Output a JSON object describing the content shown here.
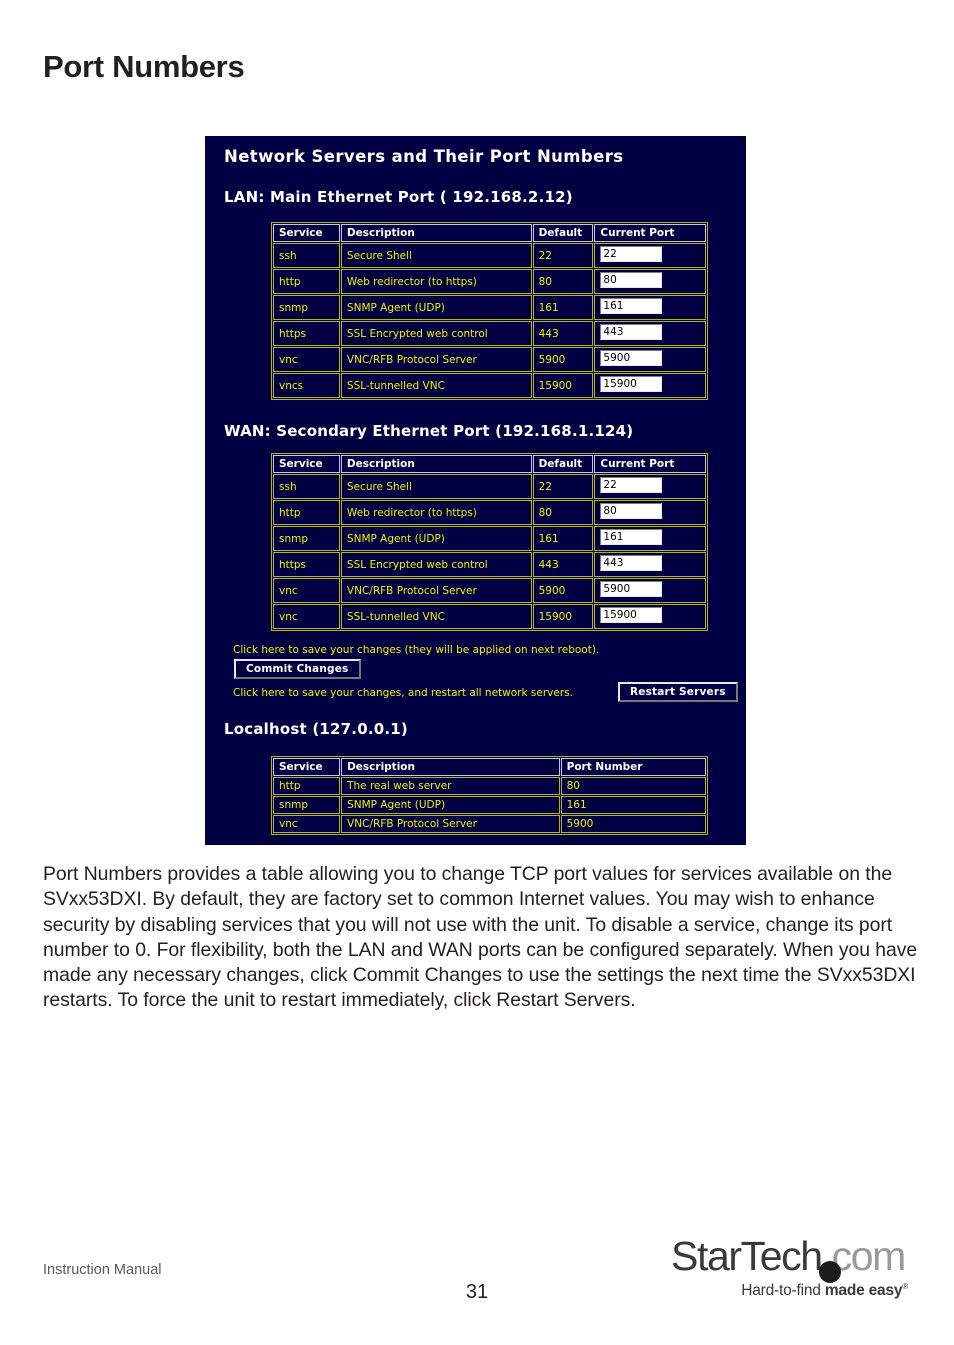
{
  "page": {
    "title": "Port Numbers",
    "body_paragraph": "Port Numbers provides a table allowing you to change TCP port values for services available on the SVxx53DXI. By default, they are factory set to common Internet values. You may wish to enhance security by disabling services that you will not use with the unit. To disable a service, change its port number to 0. For flexibility, both the LAN and WAN ports can be configured separately. When you have made any necessary changes, click Commit Changes to use the settings the next time the SVxx53DXI restarts. To force the unit to restart immediately, click Restart Servers."
  },
  "screenshot": {
    "title": "Network Servers and Their Port Numbers",
    "background_color": "#000042",
    "header_text_color": "#ffffff",
    "data_text_color": "#f2f200",
    "sections": {
      "lan": {
        "heading": "LAN: Main Ethernet Port ( 192.168.2.12)",
        "columns": [
          "Service",
          "Description",
          "Default",
          "Current Port"
        ],
        "rows": [
          {
            "service": "ssh",
            "description": "Secure Shell",
            "default": "22",
            "current": "22"
          },
          {
            "service": "http",
            "description": "Web redirector (to https)",
            "default": "80",
            "current": "80"
          },
          {
            "service": "snmp",
            "description": "SNMP Agent (UDP)",
            "default": "161",
            "current": "161"
          },
          {
            "service": "https",
            "description": "SSL Encrypted web control",
            "default": "443",
            "current": "443"
          },
          {
            "service": "vnc",
            "description": "VNC/RFB Protocol Server",
            "default": "5900",
            "current": "5900"
          },
          {
            "service": "vncs",
            "description": "SSL-tunnelled VNC",
            "default": "15900",
            "current": "15900"
          }
        ]
      },
      "wan": {
        "heading": "WAN: Secondary Ethernet Port (192.168.1.124)",
        "columns": [
          "Service",
          "Description",
          "Default",
          "Current Port"
        ],
        "rows": [
          {
            "service": "ssh",
            "description": "Secure Shell",
            "default": "22",
            "current": "22"
          },
          {
            "service": "http",
            "description": "Web redirector (to https)",
            "default": "80",
            "current": "80"
          },
          {
            "service": "snmp",
            "description": "SNMP Agent (UDP)",
            "default": "161",
            "current": "161"
          },
          {
            "service": "https",
            "description": "SSL Encrypted web control",
            "default": "443",
            "current": "443"
          },
          {
            "service": "vnc",
            "description": "VNC/RFB Protocol Server",
            "default": "5900",
            "current": "5900"
          },
          {
            "service": "vnc",
            "description": "SSL-tunnelled VNC",
            "default": "15900",
            "current": "15900"
          }
        ]
      },
      "localhost": {
        "heading": "Localhost (127.0.0.1)",
        "columns": [
          "Service",
          "Description",
          "Port Number"
        ],
        "rows": [
          {
            "service": "http",
            "description": "The real web server",
            "port": "80"
          },
          {
            "service": "snmp",
            "description": "SNMP Agent (UDP)",
            "port": "161"
          },
          {
            "service": "vnc",
            "description": "VNC/RFB Protocol Server",
            "port": "5900"
          }
        ]
      }
    },
    "actions": {
      "commit_note": "Click here to save your changes (they will be applied on next reboot).",
      "commit_button": "Commit Changes",
      "restart_note": "Click here to save your changes, and restart all network servers.",
      "restart_button": "Restart Servers"
    }
  },
  "footer": {
    "label": "Instruction Manual",
    "page_number": "31",
    "logo": {
      "brand": "StarTech",
      "suffix": ".com",
      "tagline_light": "Hard-to-find ",
      "tagline_bold": "made easy"
    }
  }
}
